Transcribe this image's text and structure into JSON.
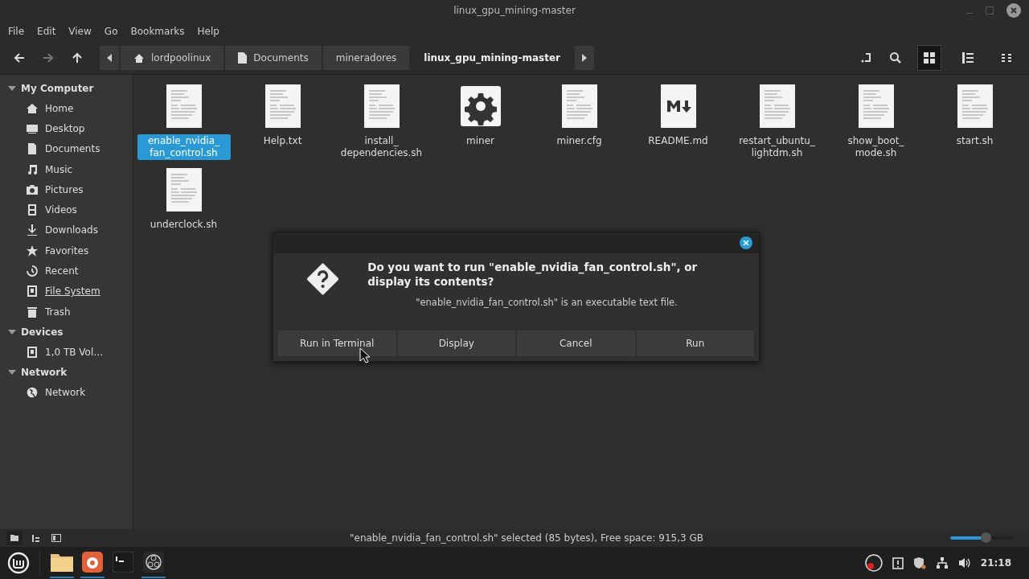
{
  "window": {
    "title": "linux_gpu_mining-master"
  },
  "menu": [
    "File",
    "Edit",
    "View",
    "Go",
    "Bookmarks",
    "Help"
  ],
  "breadcrumbs": [
    {
      "label": "lordpoolinux",
      "kind": "home",
      "selected": false
    },
    {
      "label": "Documents",
      "kind": "document",
      "selected": false
    },
    {
      "label": "mineradores",
      "kind": "folder",
      "selected": false
    },
    {
      "label": "linux_gpu_mining-master",
      "kind": "folder",
      "selected": true
    }
  ],
  "view_modes": [
    {
      "kind": "grid",
      "selected": true
    },
    {
      "kind": "list",
      "selected": false
    },
    {
      "kind": "compact",
      "selected": false
    }
  ],
  "sidebar": [
    {
      "title": "My Computer",
      "expanded": true,
      "items": [
        {
          "label": "Home",
          "kind": "home",
          "selected": false
        },
        {
          "label": "Desktop",
          "kind": "desktop",
          "selected": false
        },
        {
          "label": "Documents",
          "kind": "document",
          "selected": false
        },
        {
          "label": "Music",
          "kind": "music",
          "selected": false
        },
        {
          "label": "Pictures",
          "kind": "camera",
          "selected": false
        },
        {
          "label": "Videos",
          "kind": "film",
          "selected": false
        },
        {
          "label": "Downloads",
          "kind": "download",
          "selected": false
        },
        {
          "label": "Favorites",
          "kind": "star",
          "selected": false
        },
        {
          "label": "Recent",
          "kind": "clock",
          "selected": false
        },
        {
          "label": "File System",
          "kind": "drive",
          "selected": true
        },
        {
          "label": "Trash",
          "kind": "trash",
          "selected": false
        }
      ]
    },
    {
      "title": "Devices",
      "expanded": true,
      "items": [
        {
          "label": "1,0 TB Vol…",
          "kind": "drive",
          "selected": false
        }
      ]
    },
    {
      "title": "Network",
      "expanded": true,
      "items": [
        {
          "label": "Network",
          "kind": "globe",
          "selected": false
        }
      ]
    }
  ],
  "files": [
    {
      "name": "enable_nvidia_ fan_control.sh",
      "kind": "text",
      "selected": true
    },
    {
      "name": "Help.txt",
      "kind": "text",
      "selected": false
    },
    {
      "name": "install_ dependencies.sh",
      "kind": "text",
      "selected": false
    },
    {
      "name": "miner",
      "kind": "gear",
      "selected": false
    },
    {
      "name": "miner.cfg",
      "kind": "text",
      "selected": false
    },
    {
      "name": "README.md",
      "kind": "markdown",
      "selected": false
    },
    {
      "name": "restart_ubuntu_ lightdm.sh",
      "kind": "text",
      "selected": false
    },
    {
      "name": "show_boot_ mode.sh",
      "kind": "text",
      "selected": false
    },
    {
      "name": "start.sh",
      "kind": "text",
      "selected": false
    },
    {
      "name": "underclock.sh",
      "kind": "text",
      "selected": false
    }
  ],
  "dialog": {
    "heading": "Do you want to run \"enable_nvidia_fan_control.sh\", or display its contents?",
    "message": "\"enable_nvidia_fan_control.sh\" is an executable text file.",
    "buttons": [
      "Run in Terminal",
      "Display",
      "Cancel",
      "Run"
    ]
  },
  "status_bar": {
    "text": "\"enable_nvidia_fan_control.sh\" selected (85 bytes), Free space: 915,3 GB",
    "zoom": {
      "level": 0.57
    }
  },
  "taskbar": {
    "apps": [
      {
        "kind": "folder",
        "running": true
      },
      {
        "kind": "browser",
        "running": true
      },
      {
        "kind": "terminal",
        "running": false
      },
      {
        "kind": "recorder",
        "running": true
      }
    ],
    "clock": "21:18"
  }
}
